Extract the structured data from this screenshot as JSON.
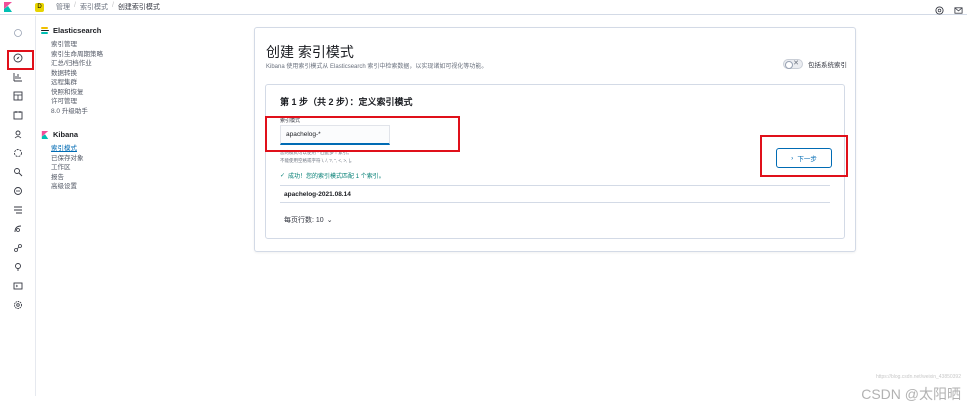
{
  "breadcrumbs": [
    "管理",
    "索引模式",
    "创建索引模式"
  ],
  "space_badge": "D",
  "nav": {
    "elasticsearch": {
      "title": "Elasticsearch",
      "items": [
        "索引管理",
        "索引生命周期策略",
        "汇总/归档作业",
        "数据转换",
        "远程集群",
        "快照和恢复",
        "许可管理",
        "8.0 升级助手"
      ]
    },
    "kibana": {
      "title": "Kibana",
      "items": [
        "索引模式",
        "已保存对象",
        "工作区",
        "报告",
        "高级设置"
      ]
    }
  },
  "page": {
    "title": "创建 索引模式",
    "description": "Kibana 使用索引模式从 Elasticsearch 索引中检索数据，以实现诸如可视化等功能。",
    "toggle_label": "包括系统索引",
    "step_title": "第 1 步（共 2 步）：定义索引模式",
    "field_label": "索引模式",
    "field_value": "apachelog-*",
    "help_line1": "您的模式可以使用 * 匹配多个索引。",
    "help_line2": "不能使用空格或字符 \\, /, ?, \", <, >, |。",
    "success_text": "成功！您的索引模式匹配 1 个索引。",
    "next_button": "下一步",
    "match_rows": [
      "apachelog-2021.08.14"
    ],
    "per_page": "每页行数: 10"
  },
  "watermark": "CSDN @太阳晒",
  "watermark_small": "https://blog.csdn.net/weixin_43850392"
}
